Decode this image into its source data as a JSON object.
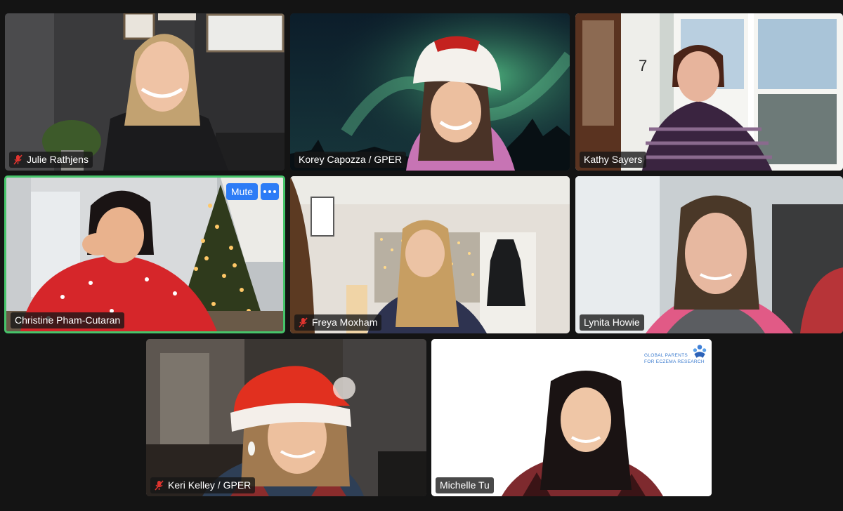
{
  "meeting": {
    "participants": [
      {
        "name": "Julie Rathjens",
        "muted": true
      },
      {
        "name": "Korey Capozza / GPER",
        "muted": false
      },
      {
        "name": "Kathy Sayers",
        "muted": false
      },
      {
        "name": "Christine Pham-Cutaran",
        "muted": false,
        "active_speaker": true
      },
      {
        "name": "Freya Moxham",
        "muted": true
      },
      {
        "name": "Lynita Howie",
        "muted": false
      },
      {
        "name": "Keri Kelley / GPER",
        "muted": true
      },
      {
        "name": "Michelle Tu",
        "muted": false
      }
    ],
    "tile_controls": {
      "mute_label": "Mute",
      "more_icon": "ellipsis-icon"
    },
    "kathy_house_number": "7",
    "logo": {
      "line1": "GLOBAL PARENTS",
      "line2": "FOR ECZEMA RESEARCH"
    },
    "colors": {
      "background": "#141414",
      "active_border": "#46c46a",
      "button_blue": "#2d7cf6",
      "muted_red": "#e0342f"
    }
  }
}
